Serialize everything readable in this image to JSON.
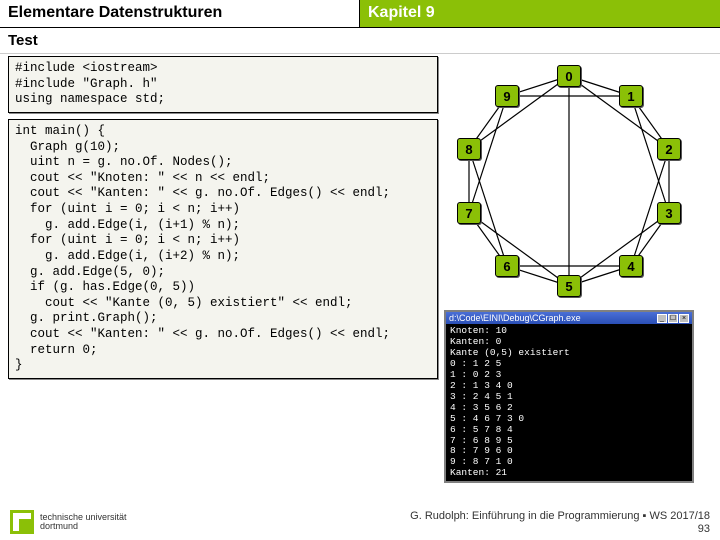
{
  "header": {
    "left": "Elementare Datenstrukturen",
    "right": "Kapitel 9"
  },
  "subhead": "Test",
  "code1": "#include <iostream>\n#include \"Graph. h\"\nusing namespace std;",
  "code2": "int main() {\n  Graph g(10);\n  uint n = g. no.Of. Nodes();\n  cout << \"Knoten: \" << n << endl;\n  cout << \"Kanten: \" << g. no.Of. Edges() << endl;\n  for (uint i = 0; i < n; i++)\n    g. add.Edge(i, (i+1) % n);\n  for (uint i = 0; i < n; i++)\n    g. add.Edge(i, (i+2) % n);\n  g. add.Edge(5, 0);\n  if (g. has.Edge(0, 5))\n    cout << \"Kante (0, 5) existiert\" << endl;\n  g. print.Graph();\n  cout << \"Kanten: \" << g. no.Of. Edges() << endl;\n  return 0;\n}",
  "chart_data": {
    "type": "graph",
    "title": "",
    "nodes": [
      0,
      1,
      2,
      3,
      4,
      5,
      6,
      7,
      8,
      9
    ],
    "edges": [
      [
        0,
        1
      ],
      [
        1,
        2
      ],
      [
        2,
        3
      ],
      [
        3,
        4
      ],
      [
        4,
        5
      ],
      [
        5,
        6
      ],
      [
        6,
        7
      ],
      [
        7,
        8
      ],
      [
        8,
        9
      ],
      [
        9,
        0
      ],
      [
        0,
        2
      ],
      [
        1,
        3
      ],
      [
        2,
        4
      ],
      [
        3,
        5
      ],
      [
        4,
        6
      ],
      [
        5,
        7
      ],
      [
        6,
        8
      ],
      [
        7,
        9
      ],
      [
        8,
        0
      ],
      [
        9,
        1
      ],
      [
        5,
        0
      ]
    ],
    "layout": "circle"
  },
  "nodes": {
    "n0": "0",
    "n1": "1",
    "n2": "2",
    "n3": "3",
    "n4": "4",
    "n5": "5",
    "n6": "6",
    "n7": "7",
    "n8": "8",
    "n9": "9"
  },
  "console": {
    "title": "d:\\Code\\EINI\\Debug\\CGraph.exe",
    "body": "Knoten: 10\nKanten: 0\nKante (0,5) existiert\n0 : 1 2 5\n1 : 0 2 3\n2 : 1 3 4 0\n3 : 2 4 5 1\n4 : 3 5 6 2\n5 : 4 6 7 3 0\n6 : 5 7 8 4\n7 : 6 8 9 5\n8 : 7 9 6 0\n9 : 8 7 1 0\nKanten: 21"
  },
  "footer": {
    "line1": "G. Rudolph: Einführung in die Programmierung ▪ WS 2017/18",
    "line2": "93"
  },
  "logo": {
    "line1": "technische universität",
    "line2": "dortmund"
  }
}
